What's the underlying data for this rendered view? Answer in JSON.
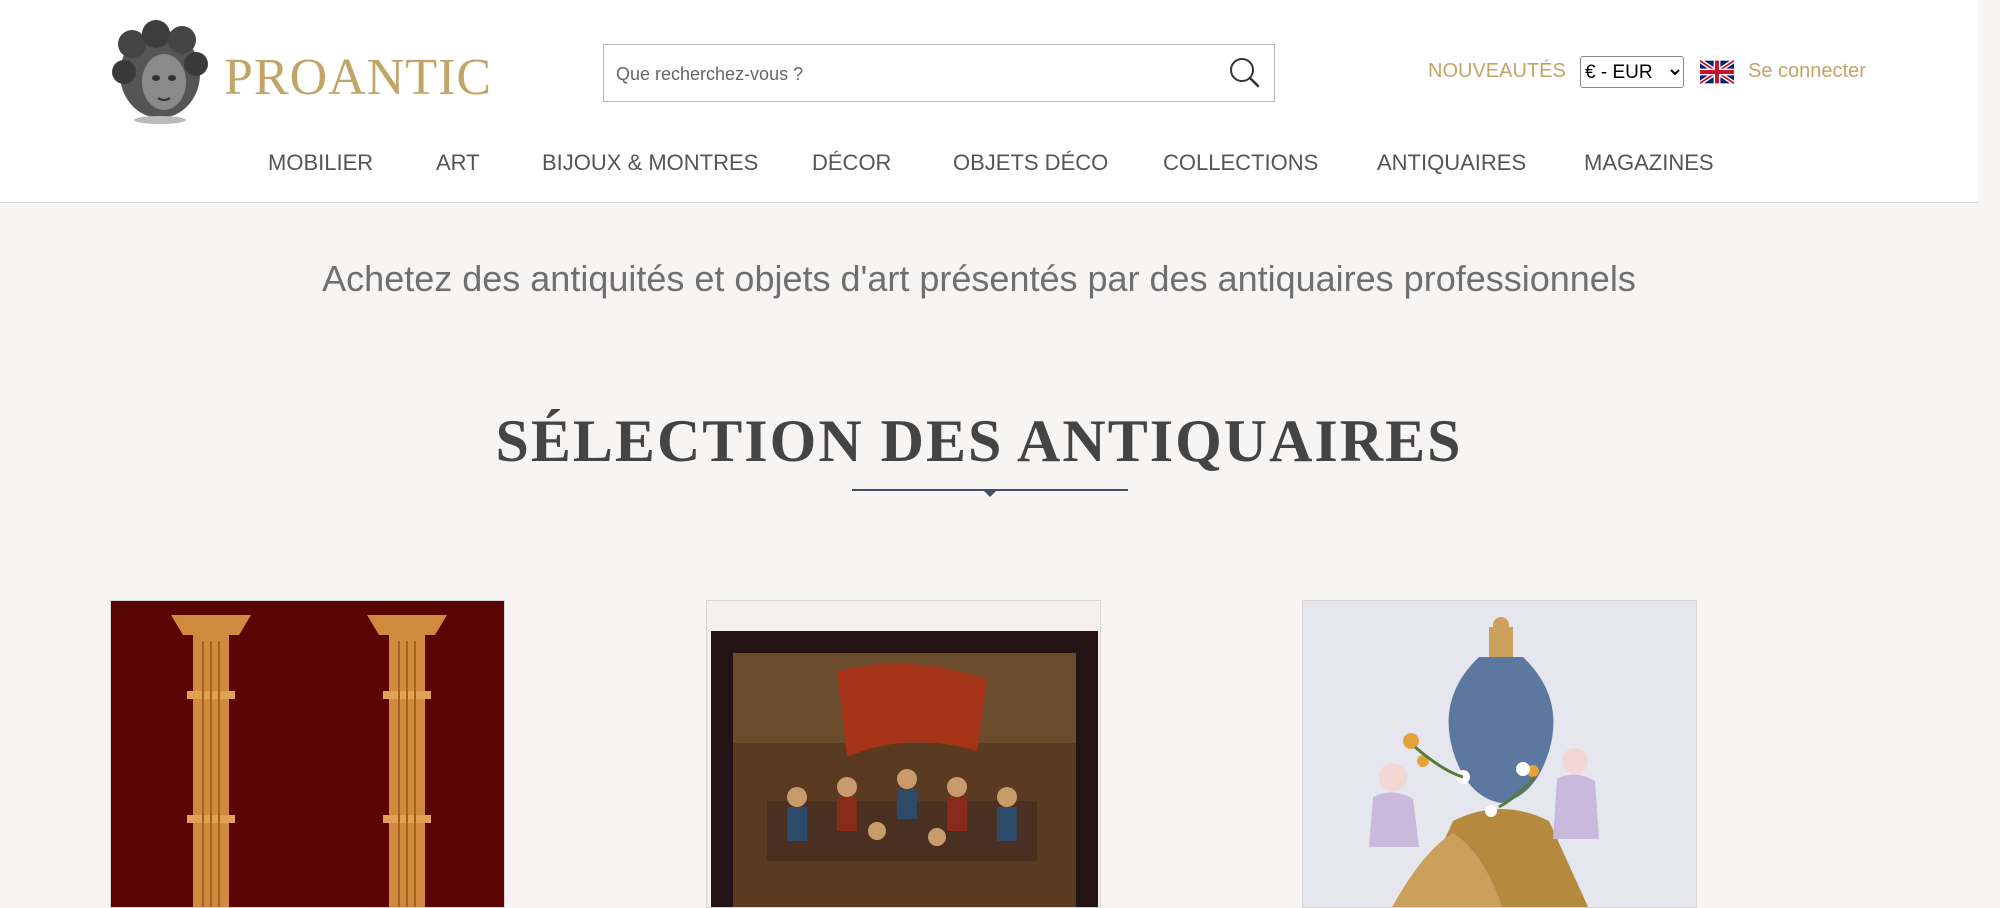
{
  "header": {
    "logo_text": "PROANTIC",
    "search": {
      "placeholder": "Que recherchez-vous ?"
    },
    "nouveautes": "NOUVEAUTÉS",
    "currency": {
      "selected": "€ - EUR"
    },
    "login": "Se connecter"
  },
  "nav": {
    "items": [
      {
        "label": "MOBILIER"
      },
      {
        "label": "ART"
      },
      {
        "label": "BIJOUX & MONTRES"
      },
      {
        "label": "DÉCOR"
      },
      {
        "label": "OBJETS DÉCO"
      },
      {
        "label": "COLLECTIONS"
      },
      {
        "label": "ANTIQUAIRES"
      },
      {
        "label": "MAGAZINES"
      }
    ]
  },
  "main": {
    "tagline": "Achetez des antiquités et objets d'art présentés par des antiquaires professionnels",
    "section_title": "SÉLECTION DES ANTIQUAIRES",
    "cards": [
      {
        "icon": "candlesticks-image"
      },
      {
        "icon": "tavern-painting-image"
      },
      {
        "icon": "porcelain-vase-image"
      }
    ]
  },
  "colors": {
    "gold": "#c2a467",
    "navy": "#3f5066",
    "background": "#f7f5f4"
  }
}
